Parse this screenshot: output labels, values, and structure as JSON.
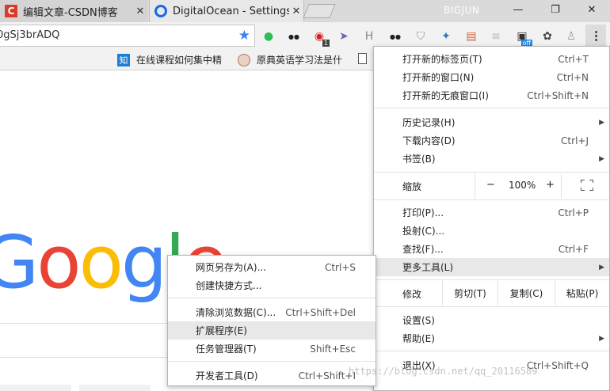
{
  "tabs": [
    {
      "title": "编辑文章-CSDN博客",
      "icon": "csdn-icon",
      "close": "✕"
    },
    {
      "title": "DigitalOcean - Settings",
      "icon": "digitalocean-icon",
      "close": "✕"
    }
  ],
  "window": {
    "profile": "BIGJUN",
    "minimize": "—",
    "maximize": "❐",
    "close": "✕"
  },
  "omnibox": {
    "url_fragment": "0gSj3brADQ"
  },
  "extensions": [
    {
      "name": "green-circle-icon",
      "glyph": "●",
      "color": "#2fbe53"
    },
    {
      "name": "tampermonkey-icon",
      "glyph": "●●",
      "color": "#222222"
    },
    {
      "name": "adblock-icon",
      "glyph": "◉",
      "color": "#d62020",
      "badge": "1"
    },
    {
      "name": "cursor-icon",
      "glyph": "➤",
      "color": "#7a5bb5"
    },
    {
      "name": "h-icon",
      "glyph": "H",
      "color": "#8a8a8a"
    },
    {
      "name": "tampermonkey-2-icon",
      "glyph": "●●",
      "color": "#222222"
    },
    {
      "name": "shield-icon",
      "glyph": "⛉",
      "color": "#9a9a9a"
    },
    {
      "name": "puzzle-icon",
      "glyph": "✦",
      "color": "#2f79c7"
    },
    {
      "name": "grid-icon",
      "glyph": "▤",
      "color": "#d6633a"
    },
    {
      "name": "lines-icon",
      "glyph": "≡",
      "color": "#bbbbbb"
    },
    {
      "name": "camera-off-icon",
      "glyph": "▣",
      "color": "#333333",
      "badge": "off"
    },
    {
      "name": "evernote-icon",
      "glyph": "✿",
      "color": "#444444"
    },
    {
      "name": "tree-icon",
      "glyph": "♙",
      "color": "#999999"
    }
  ],
  "bookmarks": [
    {
      "label": "在线课程如何集中精",
      "icon": "zhihu-icon",
      "icon_text": "知"
    },
    {
      "label": "原典英语学习法是什",
      "icon": "avatar-icon"
    },
    {
      "label": "",
      "icon": "page-icon"
    }
  ],
  "page": {
    "logo_letters": [
      "G",
      "o",
      "o",
      "g",
      "l",
      "e"
    ],
    "logo_colors": [
      "#4285f4",
      "#ea4335",
      "#fbbc05",
      "#4285f4",
      "#34a853",
      "#ea4335"
    ]
  },
  "main_menu": {
    "new_tab": {
      "label": "打开新的标签页(T)",
      "shortcut": "Ctrl+T"
    },
    "new_window": {
      "label": "打开新的窗口(N)",
      "shortcut": "Ctrl+N"
    },
    "incognito": {
      "label": "打开新的无痕窗口(I)",
      "shortcut": "Ctrl+Shift+N"
    },
    "history": {
      "label": "历史记录(H)"
    },
    "downloads": {
      "label": "下载内容(D)",
      "shortcut": "Ctrl+J"
    },
    "bookmarks": {
      "label": "书签(B)"
    },
    "zoom": {
      "label": "缩放",
      "minus": "−",
      "value": "100%",
      "plus": "+"
    },
    "print": {
      "label": "打印(P)...",
      "shortcut": "Ctrl+P"
    },
    "cast": {
      "label": "投射(C)..."
    },
    "find": {
      "label": "查找(F)...",
      "shortcut": "Ctrl+F"
    },
    "more_tools": {
      "label": "更多工具(L)"
    },
    "edit": {
      "label": "修改",
      "cut": "剪切(T)",
      "copy": "复制(C)",
      "paste": "粘贴(P)"
    },
    "settings": {
      "label": "设置(S)"
    },
    "help": {
      "label": "帮助(E)"
    },
    "exit": {
      "label": "退出(X)",
      "shortcut": "Ctrl+Shift+Q"
    }
  },
  "submenu": {
    "save_as": {
      "label": "网页另存为(A)...",
      "shortcut": "Ctrl+S"
    },
    "create_shortcut": {
      "label": "创建快捷方式..."
    },
    "clear_data": {
      "label": "清除浏览数据(C)...",
      "shortcut": "Ctrl+Shift+Del"
    },
    "extensions": {
      "label": "扩展程序(E)"
    },
    "task_manager": {
      "label": "任务管理器(T)",
      "shortcut": "Shift+Esc"
    },
    "dev_tools": {
      "label": "开发者工具(D)",
      "shortcut": "Ctrl+Shift+I"
    }
  },
  "watermark": "https://blog.csdn.net/qq_20116589"
}
